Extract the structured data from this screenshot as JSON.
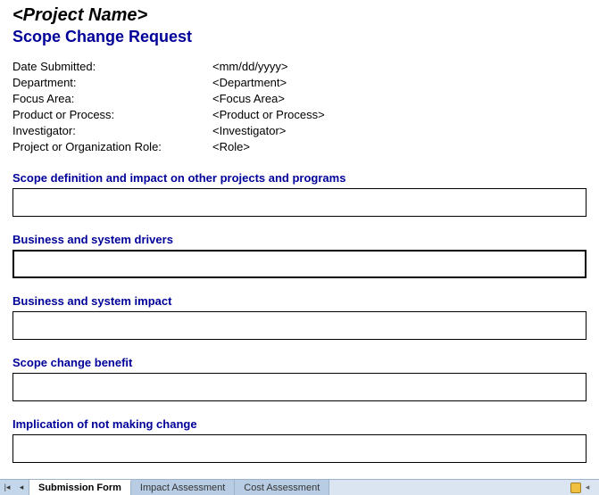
{
  "header": {
    "project_name": "<Project Name>",
    "form_title": "Scope Change Request"
  },
  "meta": [
    {
      "label": "Date Submitted:",
      "value": "<mm/dd/yyyy>"
    },
    {
      "label": "Department:",
      "value": "<Department>"
    },
    {
      "label": "Focus Area:",
      "value": "<Focus Area>"
    },
    {
      "label": "Product or Process:",
      "value": "<Product or Process>"
    },
    {
      "label": "Investigator:",
      "value": "<Investigator>"
    },
    {
      "label": "Project or Organization Role:",
      "value": "<Role>"
    }
  ],
  "sections": {
    "scope_def": {
      "heading": "Scope definition and impact on other projects and programs",
      "value": ""
    },
    "drivers": {
      "heading": "Business and system drivers",
      "value": ""
    },
    "impact": {
      "heading": "Business and system impact",
      "value": ""
    },
    "benefit": {
      "heading": "Scope change benefit",
      "value": ""
    },
    "implication": {
      "heading": "Implication of not making change",
      "value": ""
    }
  },
  "tabs": {
    "items": [
      {
        "label": "Submission Form",
        "active": true
      },
      {
        "label": "Impact Assessment",
        "active": false
      },
      {
        "label": "Cost Assessment",
        "active": false
      }
    ]
  }
}
